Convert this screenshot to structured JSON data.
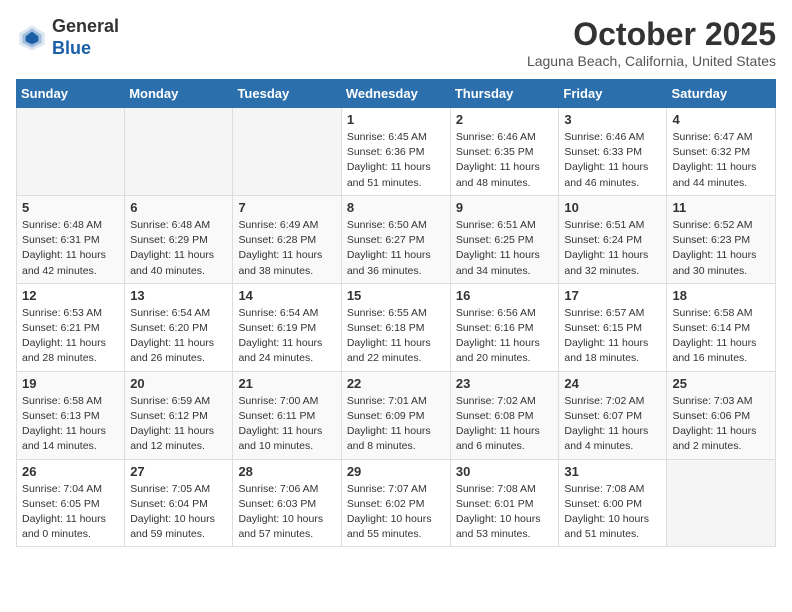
{
  "logo": {
    "general": "General",
    "blue": "Blue"
  },
  "header": {
    "month": "October 2025",
    "location": "Laguna Beach, California, United States"
  },
  "days_of_week": [
    "Sunday",
    "Monday",
    "Tuesday",
    "Wednesday",
    "Thursday",
    "Friday",
    "Saturday"
  ],
  "weeks": [
    [
      {
        "day": "",
        "sunrise": "",
        "sunset": "",
        "daylight": ""
      },
      {
        "day": "",
        "sunrise": "",
        "sunset": "",
        "daylight": ""
      },
      {
        "day": "",
        "sunrise": "",
        "sunset": "",
        "daylight": ""
      },
      {
        "day": "1",
        "sunrise": "Sunrise: 6:45 AM",
        "sunset": "Sunset: 6:36 PM",
        "daylight": "Daylight: 11 hours and 51 minutes."
      },
      {
        "day": "2",
        "sunrise": "Sunrise: 6:46 AM",
        "sunset": "Sunset: 6:35 PM",
        "daylight": "Daylight: 11 hours and 48 minutes."
      },
      {
        "day": "3",
        "sunrise": "Sunrise: 6:46 AM",
        "sunset": "Sunset: 6:33 PM",
        "daylight": "Daylight: 11 hours and 46 minutes."
      },
      {
        "day": "4",
        "sunrise": "Sunrise: 6:47 AM",
        "sunset": "Sunset: 6:32 PM",
        "daylight": "Daylight: 11 hours and 44 minutes."
      }
    ],
    [
      {
        "day": "5",
        "sunrise": "Sunrise: 6:48 AM",
        "sunset": "Sunset: 6:31 PM",
        "daylight": "Daylight: 11 hours and 42 minutes."
      },
      {
        "day": "6",
        "sunrise": "Sunrise: 6:48 AM",
        "sunset": "Sunset: 6:29 PM",
        "daylight": "Daylight: 11 hours and 40 minutes."
      },
      {
        "day": "7",
        "sunrise": "Sunrise: 6:49 AM",
        "sunset": "Sunset: 6:28 PM",
        "daylight": "Daylight: 11 hours and 38 minutes."
      },
      {
        "day": "8",
        "sunrise": "Sunrise: 6:50 AM",
        "sunset": "Sunset: 6:27 PM",
        "daylight": "Daylight: 11 hours and 36 minutes."
      },
      {
        "day": "9",
        "sunrise": "Sunrise: 6:51 AM",
        "sunset": "Sunset: 6:25 PM",
        "daylight": "Daylight: 11 hours and 34 minutes."
      },
      {
        "day": "10",
        "sunrise": "Sunrise: 6:51 AM",
        "sunset": "Sunset: 6:24 PM",
        "daylight": "Daylight: 11 hours and 32 minutes."
      },
      {
        "day": "11",
        "sunrise": "Sunrise: 6:52 AM",
        "sunset": "Sunset: 6:23 PM",
        "daylight": "Daylight: 11 hours and 30 minutes."
      }
    ],
    [
      {
        "day": "12",
        "sunrise": "Sunrise: 6:53 AM",
        "sunset": "Sunset: 6:21 PM",
        "daylight": "Daylight: 11 hours and 28 minutes."
      },
      {
        "day": "13",
        "sunrise": "Sunrise: 6:54 AM",
        "sunset": "Sunset: 6:20 PM",
        "daylight": "Daylight: 11 hours and 26 minutes."
      },
      {
        "day": "14",
        "sunrise": "Sunrise: 6:54 AM",
        "sunset": "Sunset: 6:19 PM",
        "daylight": "Daylight: 11 hours and 24 minutes."
      },
      {
        "day": "15",
        "sunrise": "Sunrise: 6:55 AM",
        "sunset": "Sunset: 6:18 PM",
        "daylight": "Daylight: 11 hours and 22 minutes."
      },
      {
        "day": "16",
        "sunrise": "Sunrise: 6:56 AM",
        "sunset": "Sunset: 6:16 PM",
        "daylight": "Daylight: 11 hours and 20 minutes."
      },
      {
        "day": "17",
        "sunrise": "Sunrise: 6:57 AM",
        "sunset": "Sunset: 6:15 PM",
        "daylight": "Daylight: 11 hours and 18 minutes."
      },
      {
        "day": "18",
        "sunrise": "Sunrise: 6:58 AM",
        "sunset": "Sunset: 6:14 PM",
        "daylight": "Daylight: 11 hours and 16 minutes."
      }
    ],
    [
      {
        "day": "19",
        "sunrise": "Sunrise: 6:58 AM",
        "sunset": "Sunset: 6:13 PM",
        "daylight": "Daylight: 11 hours and 14 minutes."
      },
      {
        "day": "20",
        "sunrise": "Sunrise: 6:59 AM",
        "sunset": "Sunset: 6:12 PM",
        "daylight": "Daylight: 11 hours and 12 minutes."
      },
      {
        "day": "21",
        "sunrise": "Sunrise: 7:00 AM",
        "sunset": "Sunset: 6:11 PM",
        "daylight": "Daylight: 11 hours and 10 minutes."
      },
      {
        "day": "22",
        "sunrise": "Sunrise: 7:01 AM",
        "sunset": "Sunset: 6:09 PM",
        "daylight": "Daylight: 11 hours and 8 minutes."
      },
      {
        "day": "23",
        "sunrise": "Sunrise: 7:02 AM",
        "sunset": "Sunset: 6:08 PM",
        "daylight": "Daylight: 11 hours and 6 minutes."
      },
      {
        "day": "24",
        "sunrise": "Sunrise: 7:02 AM",
        "sunset": "Sunset: 6:07 PM",
        "daylight": "Daylight: 11 hours and 4 minutes."
      },
      {
        "day": "25",
        "sunrise": "Sunrise: 7:03 AM",
        "sunset": "Sunset: 6:06 PM",
        "daylight": "Daylight: 11 hours and 2 minutes."
      }
    ],
    [
      {
        "day": "26",
        "sunrise": "Sunrise: 7:04 AM",
        "sunset": "Sunset: 6:05 PM",
        "daylight": "Daylight: 11 hours and 0 minutes."
      },
      {
        "day": "27",
        "sunrise": "Sunrise: 7:05 AM",
        "sunset": "Sunset: 6:04 PM",
        "daylight": "Daylight: 10 hours and 59 minutes."
      },
      {
        "day": "28",
        "sunrise": "Sunrise: 7:06 AM",
        "sunset": "Sunset: 6:03 PM",
        "daylight": "Daylight: 10 hours and 57 minutes."
      },
      {
        "day": "29",
        "sunrise": "Sunrise: 7:07 AM",
        "sunset": "Sunset: 6:02 PM",
        "daylight": "Daylight: 10 hours and 55 minutes."
      },
      {
        "day": "30",
        "sunrise": "Sunrise: 7:08 AM",
        "sunset": "Sunset: 6:01 PM",
        "daylight": "Daylight: 10 hours and 53 minutes."
      },
      {
        "day": "31",
        "sunrise": "Sunrise: 7:08 AM",
        "sunset": "Sunset: 6:00 PM",
        "daylight": "Daylight: 10 hours and 51 minutes."
      },
      {
        "day": "",
        "sunrise": "",
        "sunset": "",
        "daylight": ""
      }
    ]
  ]
}
